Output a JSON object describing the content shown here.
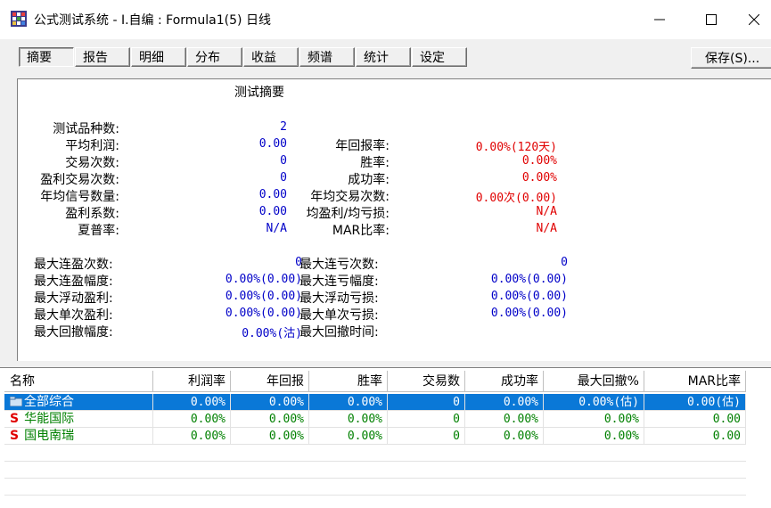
{
  "window": {
    "title": "公式测试系统 - I.自编 : Formula1(5) 日线"
  },
  "tabs": [
    {
      "label": "摘要",
      "active": true
    },
    {
      "label": "报告"
    },
    {
      "label": "明细"
    },
    {
      "label": "分布"
    },
    {
      "label": "收益"
    },
    {
      "label": "频谱"
    },
    {
      "label": "统计"
    },
    {
      "label": "设定"
    }
  ],
  "save_button": "保存(S)...",
  "summary": {
    "title": "测试摘要",
    "left": [
      {
        "label": "测试品种数:",
        "value": "2"
      },
      {
        "label": "平均利润:",
        "value": "0.00"
      },
      {
        "label": "交易次数:",
        "value": "0"
      },
      {
        "label": "盈利交易次数:",
        "value": "0"
      },
      {
        "label": "年均信号数量:",
        "value": "0.00"
      },
      {
        "label": "盈利系数:",
        "value": "0.00"
      },
      {
        "label": "夏普率:",
        "value": "N/A"
      }
    ],
    "right": [
      {
        "label": "年回报率:",
        "value": "0.00%(120天)"
      },
      {
        "label": "胜率:",
        "value": "0.00%"
      },
      {
        "label": "成功率:",
        "value": "0.00%"
      },
      {
        "label": "年均交易次数:",
        "value": "0.00次(0.00)"
      },
      {
        "label": "均盈利/均亏损:",
        "value": "N/A"
      },
      {
        "label": "MAR比率:",
        "value": "N/A"
      }
    ],
    "left2": [
      {
        "label": "最大连盈次数:",
        "value": "0"
      },
      {
        "label": "最大连盈幅度:",
        "value": "0.00%(0.00)"
      },
      {
        "label": "最大浮动盈利:",
        "value": "0.00%(0.00)"
      },
      {
        "label": "最大单次盈利:",
        "value": "0.00%(0.00)"
      },
      {
        "label": "最大回撤幅度:",
        "value": "0.00%(沽)"
      }
    ],
    "right2": [
      {
        "label": "最大连亏次数:",
        "value": "0"
      },
      {
        "label": "最大连亏幅度:",
        "value": "0.00%(0.00)"
      },
      {
        "label": "最大浮动亏损:",
        "value": "0.00%(0.00)"
      },
      {
        "label": "最大单次亏损:",
        "value": "0.00%(0.00)"
      },
      {
        "label": "最大回撤时间:",
        "value": ""
      }
    ]
  },
  "grid": {
    "headers": [
      "名称",
      "利润率",
      "年回报",
      "胜率",
      "交易数",
      "成功率",
      "最大回撤%",
      "MAR比率"
    ],
    "rows": [
      {
        "name": "全部综合",
        "values": [
          "0.00%",
          "0.00%",
          "0.00%",
          "0",
          "0.00%",
          "0.00%(估)",
          "0.00(估)"
        ]
      },
      {
        "name": "华能国际",
        "values": [
          "0.00%",
          "0.00%",
          "0.00%",
          "0",
          "0.00%",
          "0.00%",
          "0.00"
        ]
      },
      {
        "name": "国电南瑞",
        "values": [
          "0.00%",
          "0.00%",
          "0.00%",
          "0",
          "0.00%",
          "0.00%",
          "0.00"
        ]
      }
    ]
  }
}
